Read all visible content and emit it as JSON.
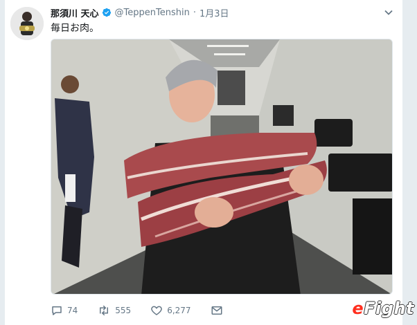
{
  "tweet": {
    "author_name": "那須川 天心",
    "handle": "@TeppenTenshin",
    "separator": "·",
    "date": "1月3日",
    "text": "毎日お肉。",
    "verified": true
  },
  "actions": {
    "reply_count": "74",
    "retweet_count": "555",
    "like_count": "6,277"
  },
  "icons": [
    "verified-badge-icon",
    "chevron-down-icon",
    "reply-icon",
    "retweet-icon",
    "heart-icon",
    "mail-icon"
  ],
  "colors": {
    "verified": "#1da1f2",
    "secondary_text": "#657786",
    "watermark_accent": "#ff2f1f"
  },
  "watermark": {
    "accent": "e",
    "rest": "Fight"
  }
}
